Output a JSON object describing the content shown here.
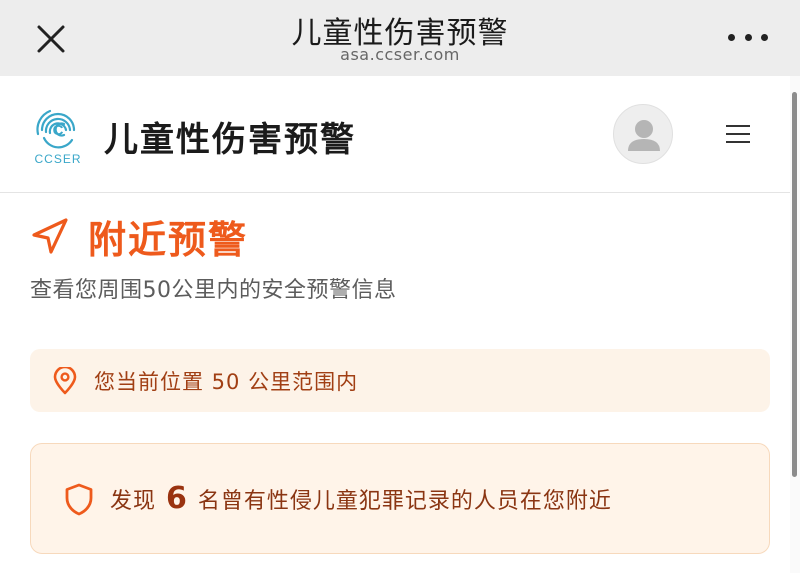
{
  "browser": {
    "title": "儿童性伤害预警",
    "url": "asa.ccser.com"
  },
  "header": {
    "logo_text": "CCSER",
    "site_title": "儿童性伤害预警"
  },
  "nearby": {
    "title": "附近预警",
    "subtitle": "查看您周围50公里内的安全预警信息",
    "location_text": "您当前位置 50 公里范围内",
    "alert_prefix": "发现",
    "alert_count": "6",
    "alert_suffix": "名曾有性侵儿童犯罪记录的人员在您附近"
  },
  "colors": {
    "accent": "#ee5a1c",
    "alert_text": "#8a3512",
    "box_bg": "#fdf3e8",
    "logo": "#3aa7c9"
  },
  "icons": [
    "close-icon",
    "more-icon",
    "fingerprint-logo",
    "user-avatar-icon",
    "hamburger-icon",
    "navigation-arrow-icon",
    "location-pin-icon",
    "shield-icon"
  ]
}
